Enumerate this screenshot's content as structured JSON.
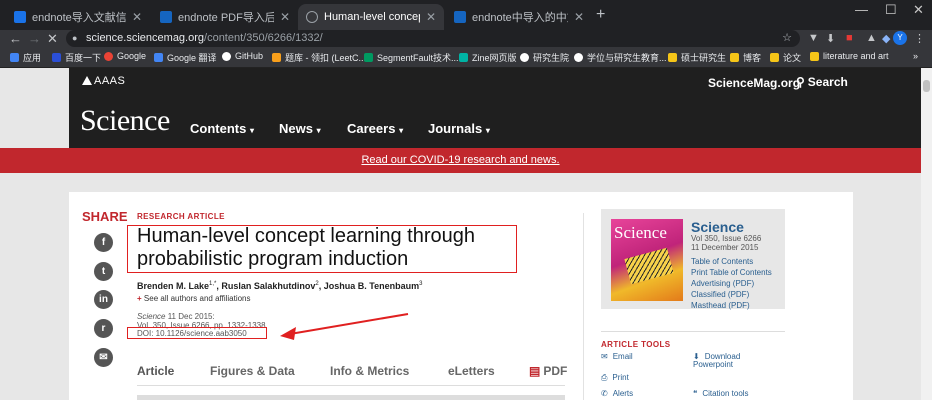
{
  "browser": {
    "tabs": [
      {
        "title": "endnote导入文献信息缺失怎么办",
        "color": "#1a73e8"
      },
      {
        "title": "endnote PDF导入后信息不全",
        "color": "#1565c0"
      },
      {
        "title": "Human-level concept learning",
        "color": "#5f6368"
      },
      {
        "title": "endnote中导入的中文文献信息",
        "color": "#1565c0"
      }
    ],
    "new_tab": "+",
    "window_controls": {
      "minimize": "—",
      "maximize": "☐",
      "close": "✕"
    },
    "nav": {
      "back": "←",
      "forward": "→",
      "reload": "✕",
      "lock": "🔒"
    },
    "url_host": "science.sciencemag.org",
    "url_path": "/content/350/6266/1332/",
    "avatar_letter": "Y",
    "bookmarks": [
      {
        "label": "应用",
        "color": "#4285f4"
      },
      {
        "label": "百度一下",
        "color": "#2b4fd6"
      },
      {
        "label": "Google",
        "color": "#ea4335"
      },
      {
        "label": "Google 翻译",
        "color": "#4285f4"
      },
      {
        "label": "GitHub",
        "color": "#ffffff"
      },
      {
        "label": "题库 - 领扣 (LeetC...",
        "color": "#f89f1b"
      },
      {
        "label": "SegmentFault技术...",
        "color": "#009a61"
      },
      {
        "label": "Zine网页版",
        "color": "#00b3a4"
      },
      {
        "label": "研究生院",
        "color": "#ffffff"
      },
      {
        "label": "学位与研究生教育...",
        "color": "#ffffff"
      },
      {
        "label": "硕士研究生",
        "color": "#f5c518"
      },
      {
        "label": "博客",
        "color": "#f5c518"
      },
      {
        "label": "论文",
        "color": "#f5c518"
      },
      {
        "label": "literature and art",
        "color": "#f5c518"
      }
    ],
    "bookmarks_more": "»"
  },
  "site": {
    "aaas_label": "AAAS",
    "site_link": "ScienceMag.org",
    "search_label": "Search",
    "logo": "Science",
    "nav": [
      "Contents",
      "News",
      "Careers",
      "Journals"
    ],
    "covid_banner": "Read our COVID-19 research and news."
  },
  "article": {
    "share_label": "SHARE",
    "share_buttons": [
      "facebook-icon",
      "twitter-icon",
      "linkedin-icon",
      "reddit-icon",
      "email-icon"
    ],
    "kicker": "RESEARCH ARTICLE",
    "title": "Human-level concept learning through probabilistic program induction",
    "authors": [
      {
        "name": "Brenden M. Lake",
        "sup": "1,*"
      },
      {
        "name": "Ruslan Salakhutdinov",
        "sup": "2"
      },
      {
        "name": "Joshua B. Tenenbaum",
        "sup": "3"
      }
    ],
    "all_authors": "See all authors and affiliations",
    "journal_italic": "Science",
    "pub_date": "11 Dec 2015:",
    "pub_issue": "Vol. 350, Issue 6266, pp. 1332-1338",
    "doi": "DOI: 10.1126/science.aab3050",
    "tabs": [
      "Article",
      "Figures & Data",
      "Info & Metrics",
      "eLetters",
      "PDF"
    ]
  },
  "sidebar": {
    "journal_name": "Science",
    "vol_issue": "Vol 350, Issue 6266",
    "issue_date": "11 December 2015",
    "links": [
      "Table of Contents",
      "Print Table of Contents",
      "Advertising (PDF)",
      "Classified (PDF)",
      "Masthead (PDF)"
    ],
    "tools_header": "ARTICLE TOOLS",
    "tools": [
      {
        "label": "Email",
        "icon": "email-icon"
      },
      {
        "label": "Download Powerpoint",
        "icon": "download-icon"
      },
      {
        "label": "Print",
        "icon": "print-icon"
      },
      {
        "label": "Alerts",
        "icon": "alerts-icon"
      },
      {
        "label": "Citation tools",
        "icon": "citation-icon"
      }
    ]
  }
}
